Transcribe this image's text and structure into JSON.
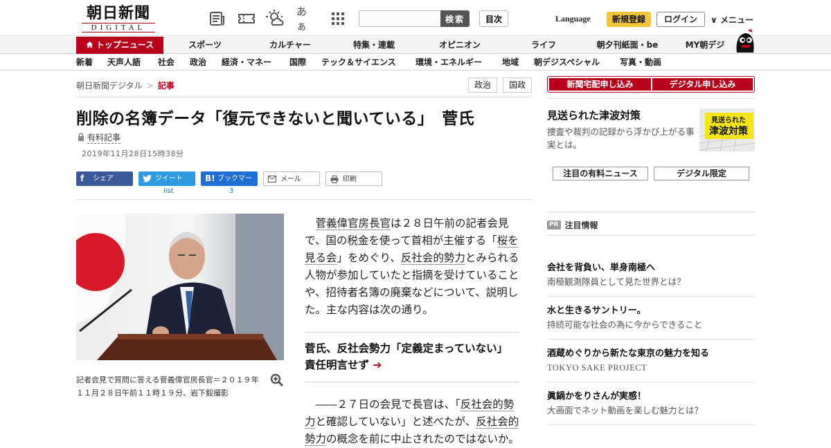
{
  "header": {
    "logo_main": "朝日新聞",
    "logo_sub": "DIGITAL",
    "search_placeholder": "",
    "search_button": "検索",
    "toc_button": "目次",
    "language": "Language",
    "register": "新規登録",
    "login": "ログイン",
    "menu": "メニュー",
    "icons": [
      "newspaper-icon",
      "ticket-icon",
      "weather-icon",
      "font-size-icon",
      "grid-menu-icon"
    ],
    "font_size_glyph": "あぁ"
  },
  "nav_main": {
    "top_news": "トップニュース",
    "items": [
      "スポーツ",
      "カルチャー",
      "特集・連載",
      "オピニオン",
      "ライフ",
      "朝夕刊紙面・be",
      "MY朝デジ"
    ]
  },
  "nav_sub": {
    "items": [
      "新着",
      "天声人語",
      "社会",
      "政治",
      "経済・マネー",
      "国際",
      "テック＆サイエンス",
      "環境・エネルギー",
      "地域",
      "朝デジスペシャル",
      "写真・動画"
    ]
  },
  "breadcrumb": {
    "items": [
      "朝日新聞デジタル",
      "記事"
    ]
  },
  "tags": [
    "政治",
    "国政"
  ],
  "article": {
    "title": "削除の名簿データ「復元できないと聞いている」　菅氏",
    "paid_label": "有料記事",
    "date": "2019年11月28日15時38分",
    "share": {
      "facebook": "シェア",
      "twitter": "ツイート",
      "hatena": "ブックマーク",
      "mail": "メール",
      "print": "印刷",
      "twitter_count": "list",
      "hatena_count": "3"
    },
    "caption": "記者会見で質問に答える菅義偉官房長官＝２０１９年１１月２８日午前１１時１９分、岩下毅撮影",
    "body1": {
      "kw1": "菅義偉官房長官",
      "t1": "は２８日午前の記者会見で、国の税金を使って首相が主催する「",
      "kw2": "桜を見る会",
      "t2": "」をめぐり、",
      "kw3": "反社会的勢力",
      "t3": "とみられる人物が参加していたと指摘を受けていることや、招待者名簿の廃棄などについて、説明した。主な内容は次の通り。"
    },
    "related": "菅氏、反社会勢力「定義定まっていない」　責任明言せず",
    "related_arrow": "➔",
    "body2": {
      "t1": "――２７日の会見で長官は、「",
      "kw1": "反社会的勢力",
      "t2": "と確認していない」と述べたが、",
      "kw2": "反社会的勢力",
      "t3": "の概念を前に中止されたのではないか。"
    }
  },
  "sidebar": {
    "subscribe_paper": "新聞宅配申し込み",
    "subscribe_digital": "デジタル申し込み",
    "feature": {
      "title": "見送られた津波対策",
      "desc": "捜査や裁判の記録から浮かび上がる事実とは。",
      "thumb_line1": "見送られた",
      "thumb_line2": "津波対策"
    },
    "tabs": [
      "注目の有料ニュース",
      "デジタル限定"
    ],
    "pr_badge": "PR",
    "pr_head": "注目情報",
    "pr_items": [
      {
        "title": "会社を背負い、単身南極へ",
        "desc": "南極観測隊員として見た世界とは？"
      },
      {
        "title": "水と生きるサントリー。",
        "desc": "持続可能な社会の為に今からできること"
      },
      {
        "title": "酒蔵めぐりから新たな東京の魅力を知る",
        "desc": "TOKYO SAKE PROJECT"
      },
      {
        "title": "眞鍋かをりさんが実感！",
        "desc": "大画面でネット動画を楽しむ魅力とは？"
      }
    ]
  },
  "colors": {
    "brand_red": "#b8001c",
    "register_yellow": "#f3c63a",
    "facebook": "#3b5998",
    "twitter": "#2f9ae0",
    "hatena": "#1f6ed3"
  }
}
